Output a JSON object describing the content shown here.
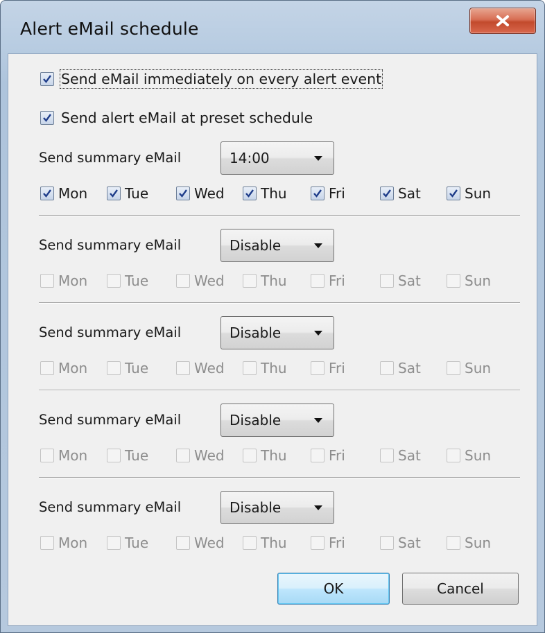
{
  "window": {
    "title": "Alert eMail schedule"
  },
  "options": [
    {
      "label": "Send eMail immediately on every alert event",
      "checked": true
    },
    {
      "label": "Send alert eMail at preset schedule",
      "checked": true
    }
  ],
  "day_names": [
    "Mon",
    "Tue",
    "Wed",
    "Thu",
    "Fri",
    "Sat",
    "Sun"
  ],
  "schedules": [
    {
      "label": "Send summary eMail",
      "value": "14:00",
      "enabled": true,
      "days": [
        true,
        true,
        true,
        true,
        true,
        true,
        true
      ]
    },
    {
      "label": "Send summary eMail",
      "value": "Disable",
      "enabled": false,
      "days": [
        false,
        false,
        false,
        false,
        false,
        false,
        false
      ]
    },
    {
      "label": "Send summary eMail",
      "value": "Disable",
      "enabled": false,
      "days": [
        false,
        false,
        false,
        false,
        false,
        false,
        false
      ]
    },
    {
      "label": "Send summary eMail",
      "value": "Disable",
      "enabled": false,
      "days": [
        false,
        false,
        false,
        false,
        false,
        false,
        false
      ]
    },
    {
      "label": "Send summary eMail",
      "value": "Disable",
      "enabled": false,
      "days": [
        false,
        false,
        false,
        false,
        false,
        false,
        false
      ]
    }
  ],
  "buttons": {
    "ok": "OK",
    "cancel": "Cancel"
  },
  "icons": {
    "close": "close-icon",
    "check": "checkmark-icon",
    "dropdown": "chevron-down-icon"
  },
  "colors": {
    "check": "#1f3d8a",
    "close_button": "#c24a2c",
    "default_button": "#bee6fd"
  }
}
